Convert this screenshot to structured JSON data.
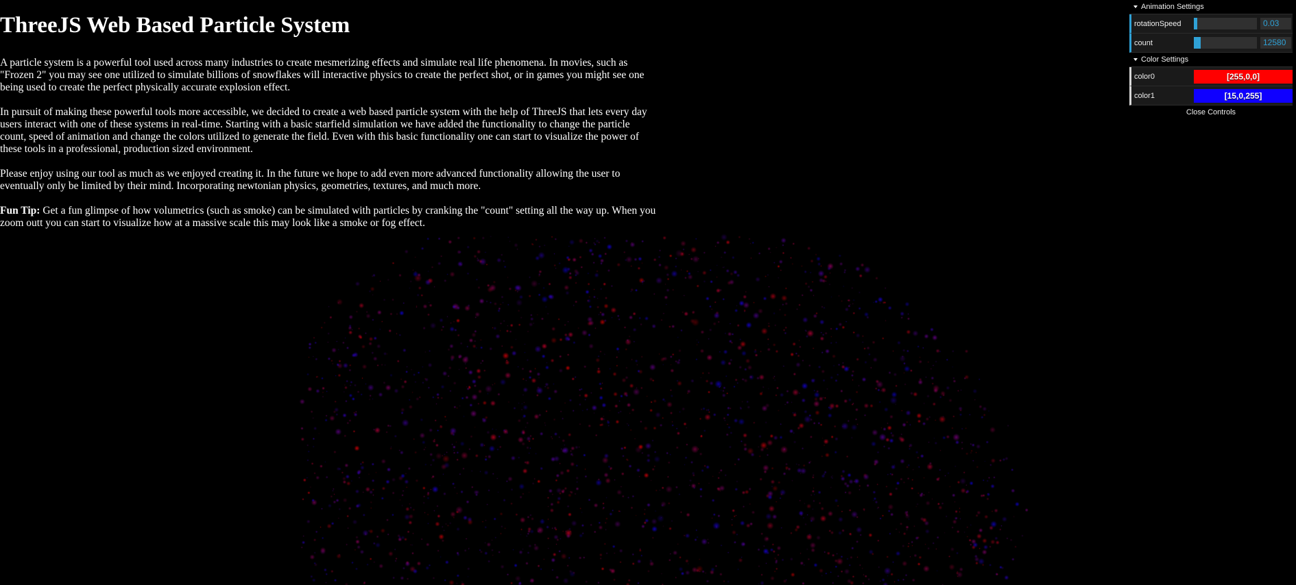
{
  "page": {
    "title": "ThreeJS Web Based Particle System",
    "paragraphs": [
      "A particle system is a powerful tool used across many industries to create mesmerizing effects and simulate real life phenomena. In movies, such as \"Frozen 2\" you may see one utilized to simulate billions of snowflakes will interactive physics to create the perfect shot, or in games you might see one being used to create the perfect physically accurate explosion effect.",
      "In pursuit of making these powerful tools more accessible, we decided to create a web based particle system with the help of ThreeJS that lets every day users interact with one of these systems in real-time. Starting with a basic starfield simulation we have added the functionality to change the particle count, speed of animation and change the colors utilized to generate the field. Even with this basic functionality one can start to visualize the power of these tools in a professional, production sized environment.",
      "Please enjoy using our tool as much as we enjoyed creating it. In the future we hope to add even more advanced functionality allowing the user to eventually only be limited by their mind. Incorporating newtonian physics, geometries, textures, and much more."
    ],
    "tip_label": "Fun Tip:",
    "tip_text": " Get a fun glimpse of how volumetrics (such as smoke) can be simulated with particles by cranking the \"count\" setting all the way up. When you zoom outt you can start to visualize how at a massive scale this may look like a smoke or fog effect."
  },
  "controls": {
    "animation_folder": "Animation Settings",
    "rotation_label": "rotationSpeed",
    "rotation_value": "0.03",
    "rotation_fraction": 0.05,
    "count_label": "count",
    "count_value": "12580",
    "count_fraction": 0.11,
    "color_folder": "Color Settings",
    "color0_label": "color0",
    "color0_value": "[255,0,0]",
    "color0_hex": "#ff0000",
    "color1_label": "color1",
    "color1_value": "[15,0,255]",
    "color1_hex": "#0f00ff",
    "close_label": "Close Controls"
  }
}
